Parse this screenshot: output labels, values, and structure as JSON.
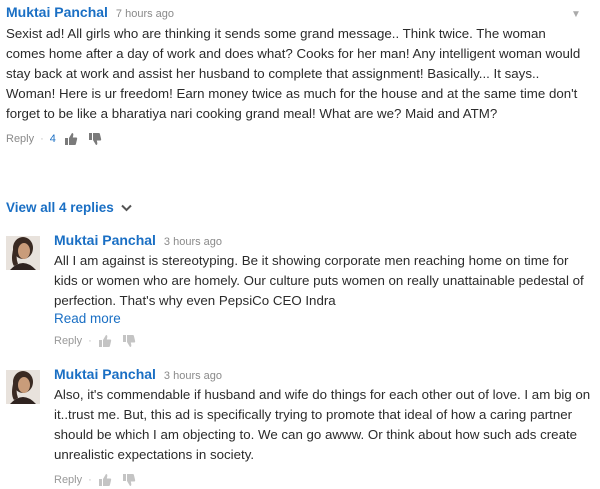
{
  "top_comment": {
    "author": "Muktai Panchal",
    "time": "7 hours ago",
    "text": "Sexist ad! All girls who are thinking it sends some grand message.. Think twice. The woman comes home after a day of work and does what? Cooks for her man! Any intelligent woman would stay back at work and assist her husband to complete that assignment! Basically... It says.. Woman! Here is ur freedom! Earn money twice as much for the house and at the same time don't forget to be like a bharatiya nari cooking grand meal! What are we? Maid and ATM?",
    "reply_label": "Reply",
    "separator": "·",
    "likes": "4"
  },
  "view_replies_label": "View all 4 replies",
  "replies": [
    {
      "author": "Muktai Panchal",
      "time": "3 hours ago",
      "text": "All I am against is stereotyping. Be it showing corporate men reaching home on time for kids or women who are homely. Our culture puts women on really unattainable pedestal of perfection. That's why even PepsiCo CEO Indra",
      "read_more": "Read more",
      "reply_label": "Reply",
      "separator": "·"
    },
    {
      "author": "Muktai Panchal",
      "time": "3 hours ago",
      "text": "Also, it's commendable if husband and wife do things for each other out of love. I am big on it..trust me. But, this ad is specifically trying to promote that ideal of how a caring partner should be which I am objecting to. We can go awww. Or think about how such ads create unrealistic expectations in society.",
      "reply_label": "Reply",
      "separator": "·"
    }
  ],
  "icons": {
    "menu": "chevron-down-icon",
    "like": "thumbs-up-icon",
    "dislike": "thumbs-down-icon",
    "expand": "chevron-down-icon"
  },
  "colors": {
    "link": "#1a6fc4",
    "muted": "#8a8a8a",
    "text": "#2b2b2b"
  }
}
